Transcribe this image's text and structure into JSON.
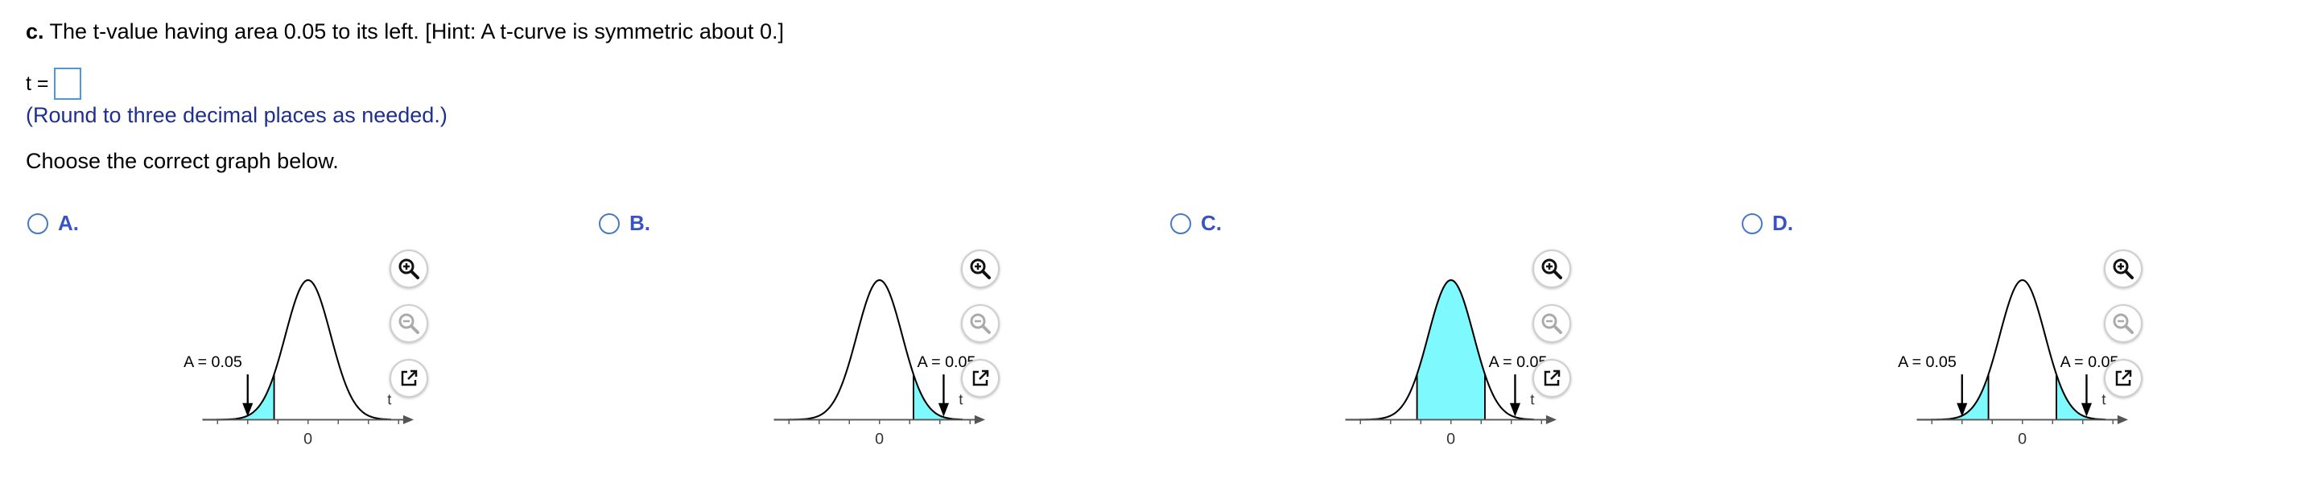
{
  "question": {
    "part": "c.",
    "text": "The t-value having area 0.05 to its left. [Hint: A t-curve is symmetric about 0.]"
  },
  "answer": {
    "prefix": "t =",
    "value": ""
  },
  "round_note": "(Round to three decimal places as needed.)",
  "choose_text": "Choose the correct graph below.",
  "options": [
    {
      "letter": "A.",
      "shade": "left",
      "labels": [
        "A = 0.05"
      ],
      "x_label": "t",
      "zero_label": "0"
    },
    {
      "letter": "B.",
      "shade": "right",
      "labels": [
        "A = 0.05"
      ],
      "x_label": "t",
      "zero_label": "0"
    },
    {
      "letter": "C.",
      "shade": "center",
      "labels": [
        "A = 0.05"
      ],
      "x_label": "t",
      "zero_label": "0"
    },
    {
      "letter": "D.",
      "shade": "both",
      "labels": [
        "A = 0.05",
        "A = 0.05"
      ],
      "x_label": "t",
      "zero_label": "0"
    }
  ],
  "colors": {
    "shade": "#7ef9fd",
    "letter": "#3a53c2",
    "note": "#1f2f8f",
    "radio": "#4a78c5"
  },
  "tool_icons": [
    "zoom-in-icon",
    "zoom-out-icon",
    "popout-icon"
  ]
}
